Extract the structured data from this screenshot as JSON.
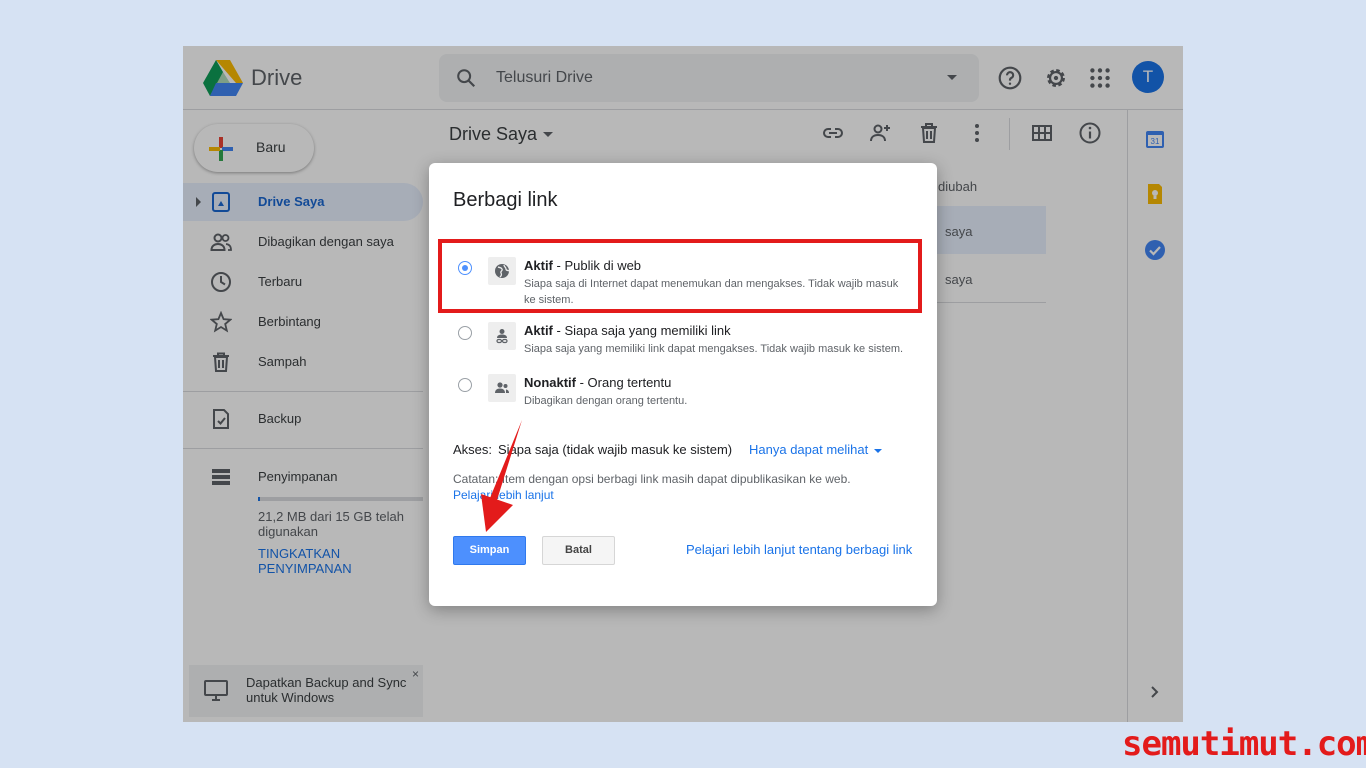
{
  "app": {
    "name": "Drive",
    "avatar_letter": "T"
  },
  "search": {
    "placeholder": "Telusuri Drive"
  },
  "sidebar": {
    "new_label": "Baru",
    "items": [
      {
        "label": "Drive Saya",
        "icon": "my-drive-icon",
        "active": true
      },
      {
        "label": "Dibagikan dengan saya",
        "icon": "shared-icon"
      },
      {
        "label": "Terbaru",
        "icon": "clock-icon"
      },
      {
        "label": "Berbintang",
        "icon": "star-icon"
      },
      {
        "label": "Sampah",
        "icon": "trash-icon"
      },
      {
        "label": "Backup",
        "icon": "backup-icon"
      },
      {
        "label": "Penyimpanan",
        "icon": "storage-icon"
      }
    ],
    "storage_used_fraction": 0.0014,
    "storage_text": "21,2 MB dari 15 GB telah digunakan",
    "upgrade_label": "TINGKATKAN PENYIMPANAN",
    "promo_text": "Dapatkan Backup and Sync untuk Windows",
    "promo_close": "×"
  },
  "main": {
    "breadcrumb": "Drive Saya",
    "column_modified": "hir diubah",
    "rows": [
      {
        "owner": "saya"
      },
      {
        "owner": "saya"
      }
    ]
  },
  "dialog": {
    "title": "Berbagi link",
    "options": [
      {
        "head": "Aktif",
        "sub": " - Publik di web",
        "desc": "Siapa saja di Internet dapat menemukan dan mengakses. Tidak wajib masuk ke sistem.",
        "checked": true,
        "icon": "globe-icon"
      },
      {
        "head": "Aktif",
        "sub": " - Siapa saja yang memiliki link",
        "desc": "Siapa saja yang memiliki link dapat mengakses. Tidak wajib masuk ke sistem.",
        "checked": false,
        "icon": "person-link-icon"
      },
      {
        "head": "Nonaktif",
        "sub": " - Orang tertentu",
        "desc": "Dibagikan dengan orang tertentu.",
        "checked": false,
        "icon": "people-icon"
      }
    ],
    "access_label": "Akses:",
    "access_value": "Siapa saja (tidak wajib masuk ke sistem)",
    "access_permission": "Hanya dapat melihat",
    "note": "Catatan: Item dengan opsi berbagi link masih dapat dipublikasikan ke web.",
    "note_link": "Pelajari lebih lanjut",
    "save_label": "Simpan",
    "cancel_label": "Batal",
    "learn_more": "Pelajari lebih lanjut tentang berbagi link"
  },
  "watermark": "semutimut.com",
  "colors": {
    "accent": "#1a73e8",
    "highlight": "#e31b1b",
    "save": "#4d90fe"
  }
}
